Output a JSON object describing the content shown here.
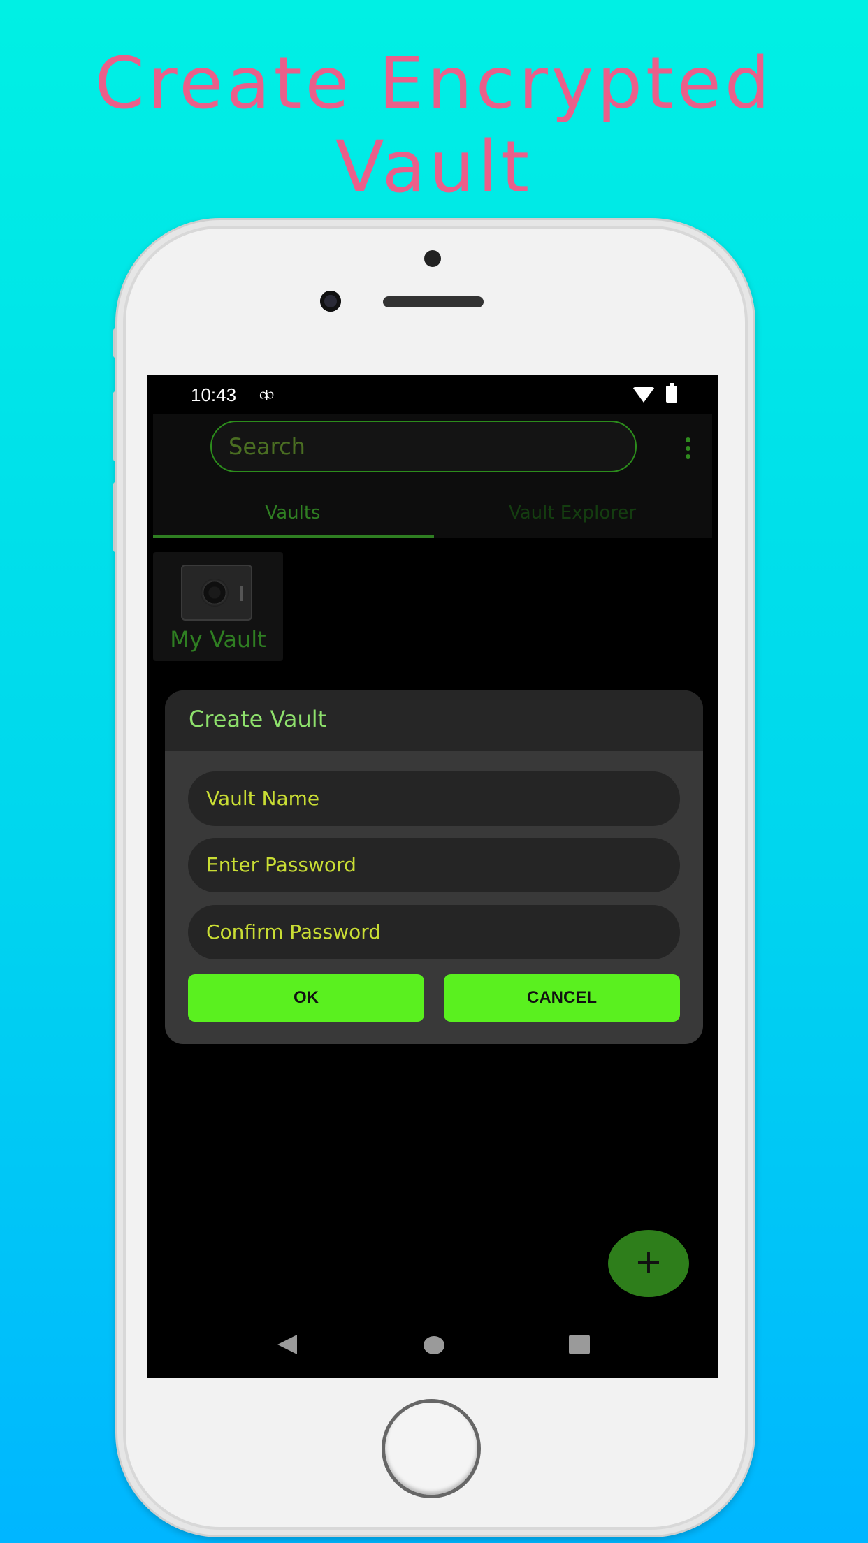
{
  "headline": "Create Encrypted Vault",
  "status_bar": {
    "time": "10:43",
    "sync_glyph": "⧞"
  },
  "search": {
    "placeholder": "Search"
  },
  "tabs": [
    {
      "label": "Vaults",
      "selected": true
    },
    {
      "label": "Vault Explorer",
      "selected": false
    }
  ],
  "vaults": [
    {
      "label": "My Vault",
      "icon": "safe-icon"
    }
  ],
  "dialog": {
    "title": "Create Vault",
    "fields": [
      {
        "placeholder": "Vault Name"
      },
      {
        "placeholder": "Enter Password"
      },
      {
        "placeholder": "Confirm Password"
      }
    ],
    "ok_label": "OK",
    "cancel_label": "CANCEL"
  },
  "fab": {
    "label": "+",
    "icon": "plus-icon"
  },
  "colors": {
    "accent_green": "#5af01f",
    "dim_green": "#2f7e22",
    "field_text": "#c9dd34",
    "headline_pink": "#ea5f8a"
  }
}
